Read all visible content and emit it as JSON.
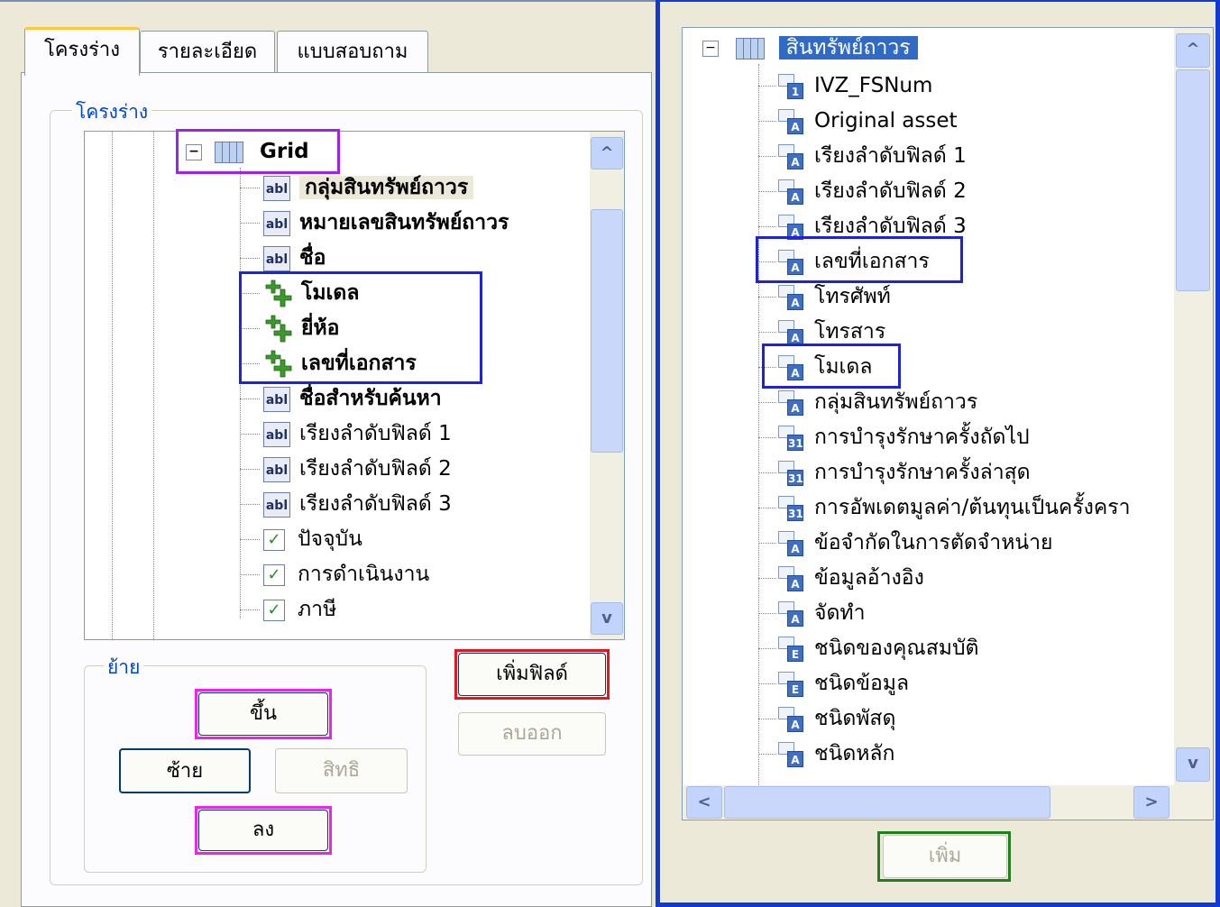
{
  "left_panel": {
    "tabs": [
      "โครงร่าง",
      "รายละเอียด",
      "แบบสอบถาม"
    ],
    "group_title": "โครงร่าง",
    "tree": {
      "root_label": "Grid",
      "items": [
        {
          "label": "กลุ่มสินทรัพย์ถาวร",
          "icon": "abl",
          "bold": true
        },
        {
          "label": "หมายเลขสินทรัพย์ถาวร",
          "icon": "abl",
          "bold": true
        },
        {
          "label": "ชื่อ",
          "icon": "abl",
          "bold": true
        },
        {
          "label": "โมเดล",
          "icon": "plus",
          "bold": true
        },
        {
          "label": "ยี่ห้อ",
          "icon": "plus",
          "bold": true
        },
        {
          "label": "เลขที่เอกสาร",
          "icon": "plus",
          "bold": true
        },
        {
          "label": "ชื่อสำหรับค้นหา",
          "icon": "abl",
          "bold": true
        },
        {
          "label": "เรียงลำดับฟิลด์ 1",
          "icon": "abl",
          "bold": false
        },
        {
          "label": "เรียงลำดับฟิลด์ 2",
          "icon": "abl",
          "bold": false
        },
        {
          "label": "เรียงลำดับฟิลด์ 3",
          "icon": "abl",
          "bold": false
        },
        {
          "label": "ปัจจุบัน",
          "icon": "check",
          "bold": false
        },
        {
          "label": "การดำเนินงาน",
          "icon": "check",
          "bold": false
        },
        {
          "label": "ภาษี",
          "icon": "check",
          "bold": false
        }
      ],
      "abl_text": "abl"
    },
    "move_group_title": "ย้าย",
    "buttons": {
      "up": "ขึ้น",
      "left": "ซ้าย",
      "rights": "สิทธิ",
      "down": "ลง",
      "add_field": "เพิ่มฟิลด์",
      "remove": "ลบออก"
    }
  },
  "right_panel": {
    "tree": {
      "root_label": "สินทรัพย์ถาวร",
      "items": [
        {
          "label": "IVZ_FSNum",
          "tag": "1"
        },
        {
          "label": "Original asset",
          "tag": "A"
        },
        {
          "label": "เรียงลำดับฟิลด์ 1",
          "tag": "A"
        },
        {
          "label": "เรียงลำดับฟิลด์ 2",
          "tag": "A"
        },
        {
          "label": "เรียงลำดับฟิลด์ 3",
          "tag": "A"
        },
        {
          "label": "เลขที่เอกสาร",
          "tag": "A"
        },
        {
          "label": "โทรศัพท์",
          "tag": "A"
        },
        {
          "label": "โทรสาร",
          "tag": "A"
        },
        {
          "label": "โมเดล",
          "tag": "A"
        },
        {
          "label": "กลุ่มสินทรัพย์ถาวร",
          "tag": "A"
        },
        {
          "label": "การบำรุงรักษาครั้งถัดไป",
          "tag": "31"
        },
        {
          "label": "การบำรุงรักษาครั้งล่าสุด",
          "tag": "31"
        },
        {
          "label": "การอัพเดตมูลค่า/ต้นทุนเป็นครั้งครา",
          "tag": "31"
        },
        {
          "label": "ข้อจำกัดในการตัดจำหน่าย",
          "tag": "A"
        },
        {
          "label": "ข้อมูลอ้างอิง",
          "tag": "A"
        },
        {
          "label": "จัดทำ",
          "tag": "A"
        },
        {
          "label": "ชนิดของคุณสมบัติ",
          "tag": "E"
        },
        {
          "label": "ชนิดข้อมูล",
          "tag": "E"
        },
        {
          "label": "ชนิดพัสดุ",
          "tag": "A"
        },
        {
          "label": "ชนิดหลัก",
          "tag": "A"
        }
      ]
    },
    "buttons": {
      "add": "เพิ่ม"
    }
  },
  "highlight_colors": {
    "purple": "#a020f0",
    "blue": "#1e22d8",
    "red": "#e8141e",
    "magenta": "#ee22ee",
    "green": "#21801e"
  }
}
